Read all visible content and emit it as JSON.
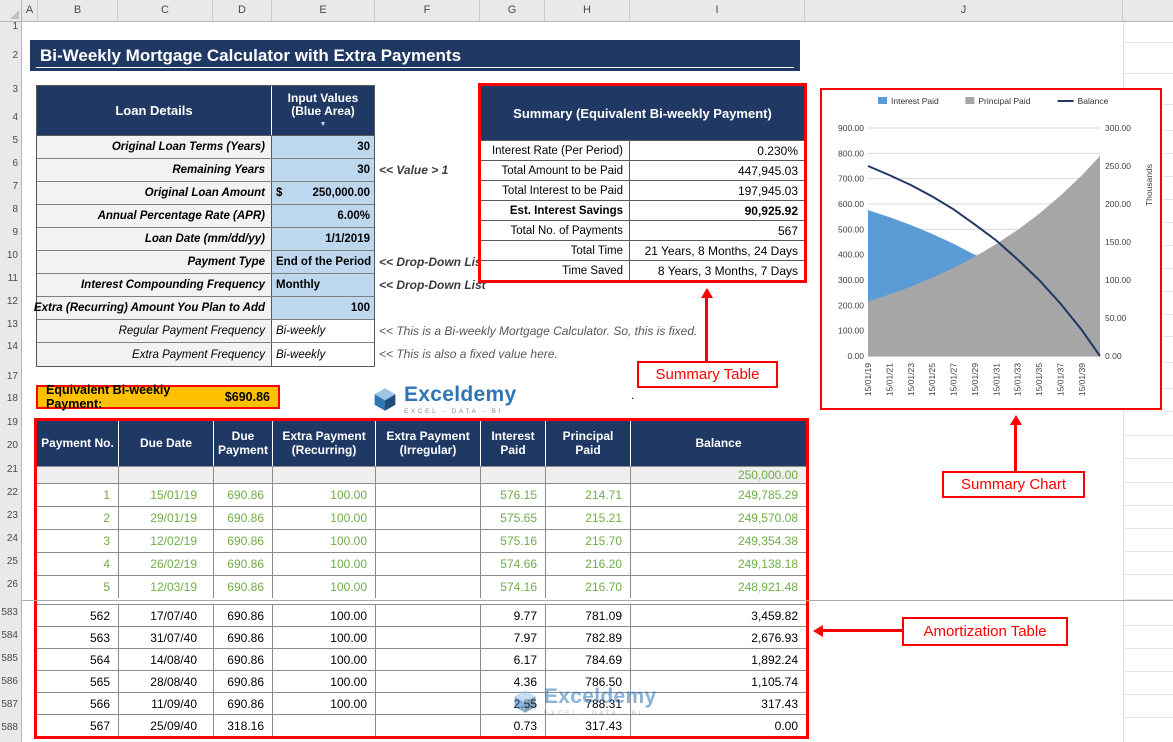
{
  "excel": {
    "columns": [
      "A",
      "B",
      "C",
      "D",
      "E",
      "F",
      "G",
      "H",
      "I",
      "J"
    ],
    "rows_top": [
      "1",
      "2",
      "3",
      "4",
      "5",
      "6",
      "7",
      "8",
      "9",
      "10",
      "11",
      "12",
      "13",
      "14",
      "17",
      "18",
      "19",
      "20",
      "21",
      "22",
      "23",
      "24",
      "25",
      "26"
    ],
    "rows_bottom": [
      "583",
      "584",
      "585",
      "586",
      "587",
      "588"
    ]
  },
  "title_banner": {
    "text": "Bi-Weekly Mortgage Calculator with Extra Payments"
  },
  "loan_details": {
    "col1_header": "Loan Details",
    "col2_header": "Input Values (Blue Area)",
    "rows": [
      {
        "label": "Original Loan Terms (Years)",
        "prefix": "",
        "value": "30",
        "style": "blue",
        "note": "",
        "note_gray": false,
        "label_bold": true
      },
      {
        "label": "Remaining Years",
        "prefix": "",
        "value": "30",
        "style": "blue",
        "note": "<< Value > 1",
        "note_gray": false,
        "label_bold": true
      },
      {
        "label": "Original Loan Amount",
        "prefix": "$",
        "value": "250,000.00",
        "style": "blue",
        "note": "",
        "note_gray": false,
        "label_bold": true
      },
      {
        "label": "Annual Percentage Rate (APR)",
        "prefix": "",
        "value": "6.00%",
        "style": "blue",
        "note": "",
        "note_gray": false,
        "label_bold": true
      },
      {
        "label": "Loan Date (mm/dd/yy)",
        "prefix": "",
        "value": "1/1/2019",
        "style": "blue",
        "note": "",
        "note_gray": false,
        "label_bold": true
      },
      {
        "label": "Payment Type",
        "prefix": "",
        "value": "End of the Period",
        "style": "blue-left",
        "note": "<< Drop-Down List",
        "note_gray": false,
        "label_bold": true
      },
      {
        "label": "Interest Compounding Frequency",
        "prefix": "",
        "value": "Monthly",
        "style": "blue-left",
        "note": "<< Drop-Down List",
        "note_gray": false,
        "label_bold": true
      },
      {
        "label": "Extra (Recurring) Amount You Plan to Add",
        "prefix": "",
        "value": "100",
        "style": "blue",
        "note": "",
        "note_gray": false,
        "label_bold": true
      },
      {
        "label": "Regular Payment Frequency",
        "prefix": "",
        "value": "Bi-weekly",
        "style": "white-italic",
        "note": "<< This is a Bi-weekly Mortgage Calculator. So, this is fixed.",
        "note_gray": true,
        "label_bold": false
      },
      {
        "label": "Extra Payment Frequency",
        "prefix": "",
        "value": "Bi-weekly",
        "style": "white-italic",
        "note": "<< This is also a fixed value here.",
        "note_gray": true,
        "label_bold": false
      }
    ]
  },
  "equivalent_payment": {
    "label": "Equivalent Bi-weekly Payment:",
    "value": "$690.86"
  },
  "summary": {
    "header": "Summary (Equivalent Bi-weekly Payment)",
    "rows": [
      {
        "label": "Interest Rate (Per Period)",
        "value": "0.230%",
        "bold": false
      },
      {
        "label": "Total Amount to be Paid",
        "value": "447,945.03",
        "bold": false
      },
      {
        "label": "Total Interest to be Paid",
        "value": "197,945.03",
        "bold": false
      },
      {
        "label": "Est. Interest Savings",
        "value": "90,925.92",
        "bold": true
      },
      {
        "label": "Total No. of Payments",
        "value": "567",
        "bold": false
      },
      {
        "label": "Total Time",
        "value": "21 Years, 8 Months, 24 Days",
        "bold": false
      },
      {
        "label": "Time Saved",
        "value": "8 Years, 3 Months, 7 Days",
        "bold": false
      }
    ]
  },
  "amortization": {
    "headers": [
      "Payment No.",
      "Due Date",
      "Due Payment",
      "Extra Payment (Recurring)",
      "Extra Payment (Irregular)",
      "Interest Paid",
      "Principal Paid",
      "Balance"
    ],
    "opening_balance": "250,000.00",
    "rows_top": [
      {
        "no": "1",
        "due_date": "15/01/19",
        "due_payment": "690.86",
        "extra_recurring": "100.00",
        "extra_irregular": "",
        "interest": "576.15",
        "principal": "214.71",
        "balance": "249,785.29"
      },
      {
        "no": "2",
        "due_date": "29/01/19",
        "due_payment": "690.86",
        "extra_recurring": "100.00",
        "extra_irregular": "",
        "interest": "575.65",
        "principal": "215.21",
        "balance": "249,570.08"
      },
      {
        "no": "3",
        "due_date": "12/02/19",
        "due_payment": "690.86",
        "extra_recurring": "100.00",
        "extra_irregular": "",
        "interest": "575.16",
        "principal": "215.70",
        "balance": "249,354.38"
      },
      {
        "no": "4",
        "due_date": "26/02/19",
        "due_payment": "690.86",
        "extra_recurring": "100.00",
        "extra_irregular": "",
        "interest": "574.66",
        "principal": "216.20",
        "balance": "249,138.18"
      },
      {
        "no": "5",
        "due_date": "12/03/19",
        "due_payment": "690.86",
        "extra_recurring": "100.00",
        "extra_irregular": "",
        "interest": "574.16",
        "principal": "216.70",
        "balance": "248,921.48"
      }
    ],
    "rows_bottom": [
      {
        "no": "562",
        "due_date": "17/07/40",
        "due_payment": "690.86",
        "extra_recurring": "100.00",
        "extra_irregular": "",
        "interest": "9.77",
        "principal": "781.09",
        "balance": "3,459.82"
      },
      {
        "no": "563",
        "due_date": "31/07/40",
        "due_payment": "690.86",
        "extra_recurring": "100.00",
        "extra_irregular": "",
        "interest": "7.97",
        "principal": "782.89",
        "balance": "2,676.93"
      },
      {
        "no": "564",
        "due_date": "14/08/40",
        "due_payment": "690.86",
        "extra_recurring": "100.00",
        "extra_irregular": "",
        "interest": "6.17",
        "principal": "784.69",
        "balance": "1,892.24"
      },
      {
        "no": "565",
        "due_date": "28/08/40",
        "due_payment": "690.86",
        "extra_recurring": "100.00",
        "extra_irregular": "",
        "interest": "4.36",
        "principal": "786.50",
        "balance": "1,105.74"
      },
      {
        "no": "566",
        "due_date": "11/09/40",
        "due_payment": "690.86",
        "extra_recurring": "100.00",
        "extra_irregular": "",
        "interest": "2.55",
        "principal": "788.31",
        "balance": "317.43"
      },
      {
        "no": "567",
        "due_date": "25/09/40",
        "due_payment": "318.16",
        "extra_recurring": "",
        "extra_irregular": "",
        "interest": "0.73",
        "principal": "317.43",
        "balance": "0.00"
      }
    ]
  },
  "annotations": {
    "summary_table": "Summary Table",
    "summary_chart": "Summary Chart",
    "amortization_table": "Amortization Table"
  },
  "logo": {
    "name": "Exceldemy",
    "tagline": "EXCEL - DATA - BI"
  },
  "misc": {
    "dot": "."
  },
  "chart_data": {
    "type": "area",
    "title": "",
    "legend_position": "top",
    "x_ticks": [
      "15/01/19",
      "15/01/21",
      "15/01/23",
      "15/01/25",
      "15/01/27",
      "15/01/29",
      "15/01/31",
      "15/01/33",
      "15/01/35",
      "15/01/37",
      "15/01/39"
    ],
    "x_tick_years": [
      0,
      2,
      4,
      6,
      8,
      10,
      12,
      14,
      16,
      18,
      20
    ],
    "x_sample_years": [
      0,
      2,
      4,
      6,
      8,
      10,
      12,
      14,
      16,
      18,
      20,
      21.7
    ],
    "x_max_years": 21.7,
    "left_axis": {
      "min": 0,
      "max": 900,
      "step": 100
    },
    "right_axis": {
      "min": 0,
      "max": 300,
      "step": 50,
      "title": "Thousands"
    },
    "series": [
      {
        "name": "Interest Paid",
        "type": "area",
        "axis": "left",
        "color": "#5B9BD5",
        "values": [
          576,
          548,
          517,
          482,
          443,
          399,
          349,
          293,
          230,
          158,
          78,
          1
        ]
      },
      {
        "name": "Principal Paid",
        "type": "area",
        "axis": "left",
        "color": "#A6A6A6",
        "values": [
          215,
          243,
          274,
          309,
          348,
          392,
          442,
          498,
          561,
          633,
          713,
          790
        ]
      },
      {
        "name": "Balance",
        "type": "line",
        "axis": "right",
        "color": "#1F3864",
        "values": [
          250,
          238,
          225,
          210,
          193,
          173,
          152,
          127,
          100,
          69,
          34,
          0
        ]
      }
    ]
  }
}
